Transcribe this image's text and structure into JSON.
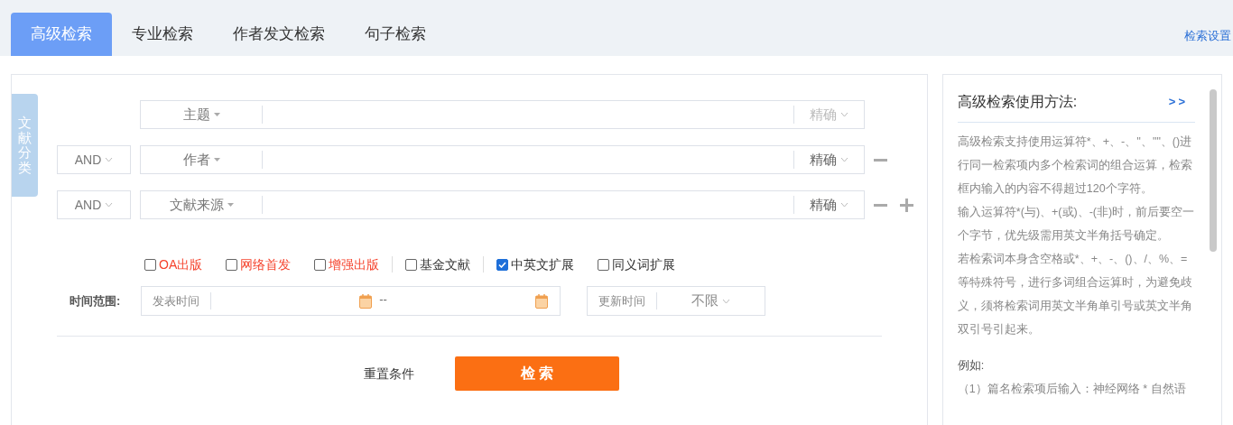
{
  "tabs": [
    {
      "label": "高级检索",
      "selected": true
    },
    {
      "label": "专业检索",
      "selected": false
    },
    {
      "label": "作者发文检索",
      "selected": false
    },
    {
      "label": "句子检索",
      "selected": false
    }
  ],
  "settings_link": "检索设置",
  "side_tab": "文献分类",
  "search_rows": [
    {
      "field": "主题",
      "match": "精确",
      "match_disabled": true,
      "removable": false,
      "addable": false
    },
    {
      "logic": "AND",
      "field": "作者",
      "match": "精确",
      "match_disabled": false,
      "removable": true,
      "addable": false
    },
    {
      "logic": "AND",
      "field": "文献来源",
      "match": "精确",
      "match_disabled": false,
      "removable": true,
      "addable": true
    }
  ],
  "checkbox_groups": [
    [
      {
        "label": "OA出版",
        "checked": false,
        "color": "#f5432d"
      },
      {
        "label": "网络首发",
        "checked": false,
        "color": "#f5432d"
      },
      {
        "label": "增强出版",
        "checked": false,
        "color": "#f5432d"
      }
    ],
    [
      {
        "label": "基金文献",
        "checked": false,
        "color": "#333333"
      }
    ],
    [
      {
        "label": "中英文扩展",
        "checked": true,
        "color": "#333333"
      },
      {
        "label": "同义词扩展",
        "checked": false,
        "color": "#333333"
      }
    ]
  ],
  "time_range": {
    "label": "时间范围:",
    "publish_placeholder": "发表时间",
    "separator": "--",
    "update_label": "更新时间",
    "update_value": "不限"
  },
  "reset_button": "重置条件",
  "search_button": "检 索",
  "help": {
    "title": "高级检索使用方法:",
    "expand": ">>",
    "paragraphs": [
      "高级检索支持使用运算符*、+、-、''、\"\"、()进行同一检索项内多个检索词的组合运算，检索框内输入的内容不得超过120个字符。",
      "输入运算符*(与)、+(或)、-(非)时，前后要空一个字节，优先级需用英文半角括号确定。",
      "若检索词本身含空格或*、+、-、()、/、%、=等特殊符号，进行多词组合运算时，为避免歧义，须将检索词用英文半角单引号或英文半角双引号引起来。"
    ],
    "example_title": "例如:",
    "example_line": "（1）篇名检索项后输入：神经网络 * 自然语"
  }
}
